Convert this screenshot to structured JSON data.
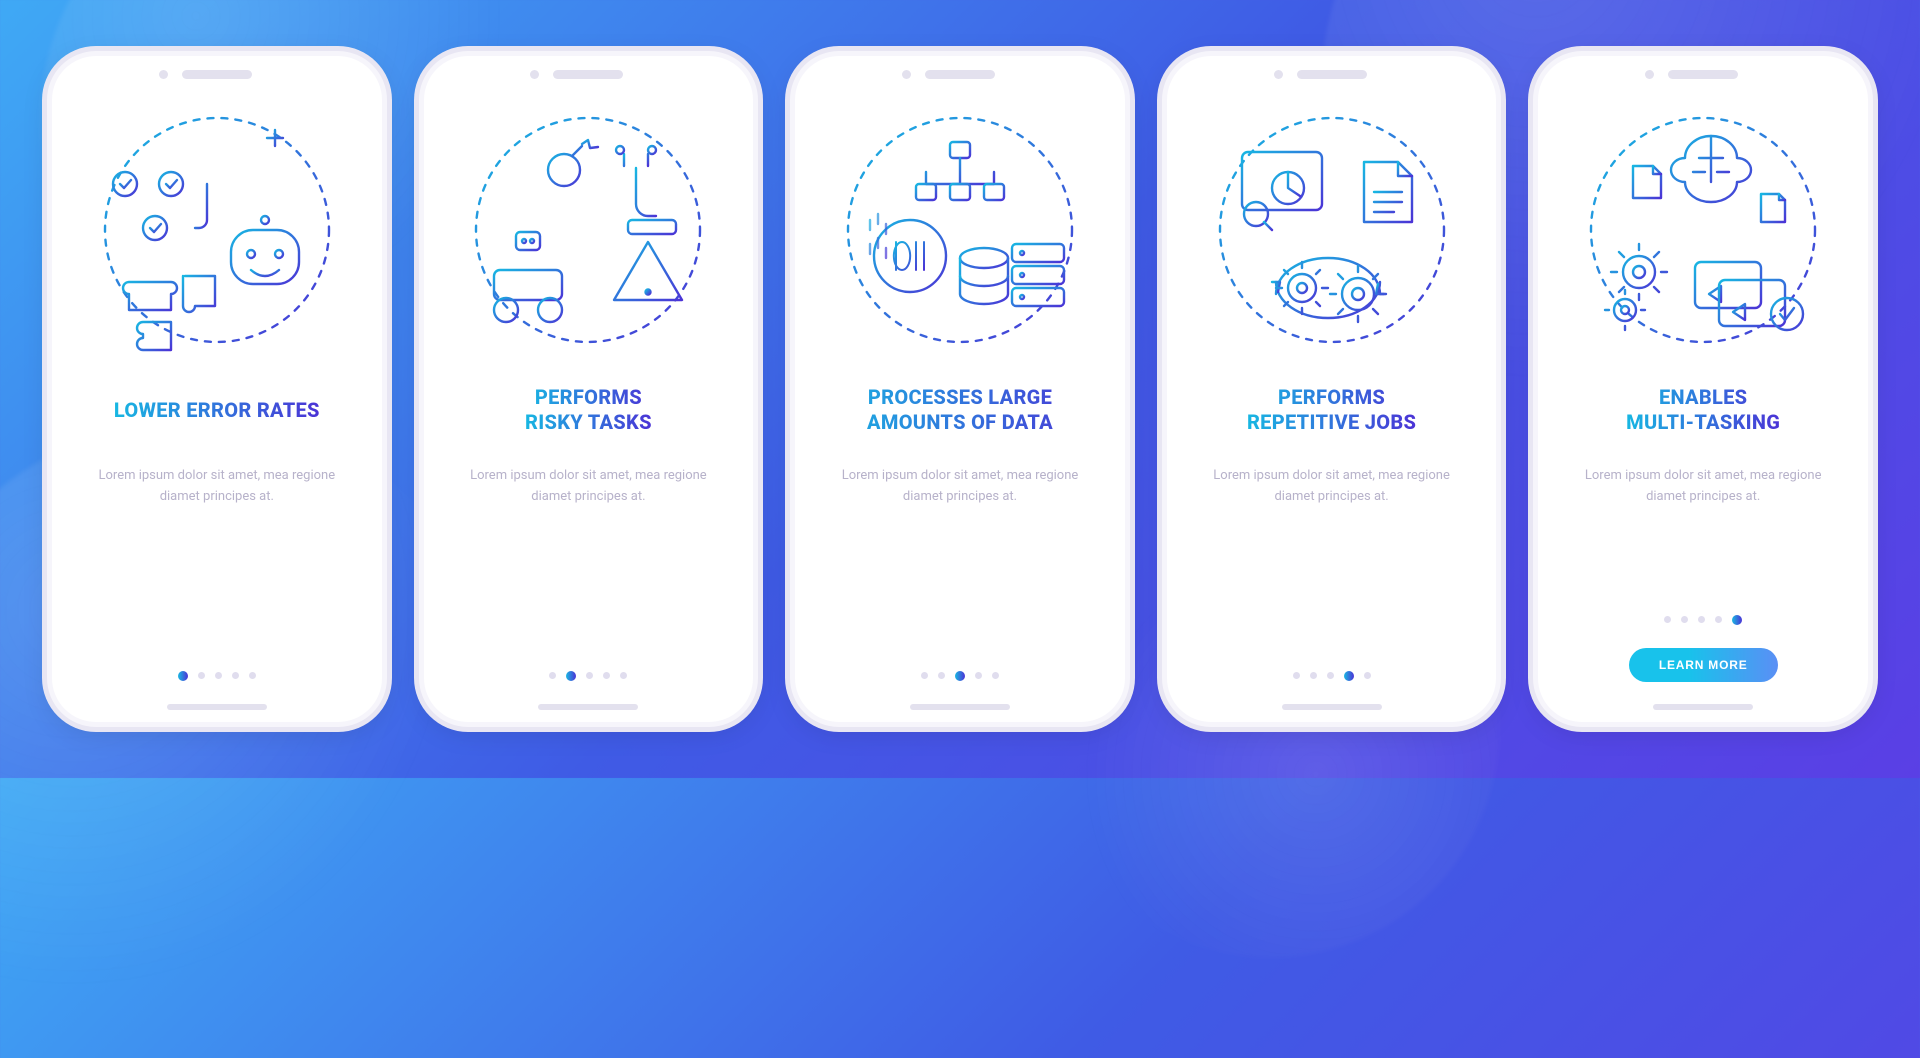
{
  "gradient": {
    "start": "#17B7E2",
    "end": "#4B33D6"
  },
  "cta": {
    "label": "LEARN MORE"
  },
  "pager": {
    "count": 5
  },
  "bodyText": "Lorem ipsum dolor sit amet, mea regione diamet principes at.",
  "cards": [
    {
      "key": "error-rates",
      "title": "LOWER ERROR RATES",
      "iconName": "robot-puzzle-icon",
      "activeIndex": 0
    },
    {
      "key": "risky-tasks",
      "title": "PERFORMS\nRISKY TASKS",
      "iconName": "robot-warning-icon",
      "activeIndex": 1
    },
    {
      "key": "large-data",
      "title": "PROCESSES LARGE AMOUNTS OF DATA",
      "iconName": "database-binary-icon",
      "activeIndex": 2
    },
    {
      "key": "repetitive-jobs",
      "title": "PERFORMS\nREPETITIVE JOBS",
      "iconName": "gears-docs-icon",
      "activeIndex": 3
    },
    {
      "key": "multitasking",
      "title": "ENABLES\nMULTI-TASKING",
      "iconName": "brain-gears-windows-icon",
      "activeIndex": 4
    }
  ]
}
